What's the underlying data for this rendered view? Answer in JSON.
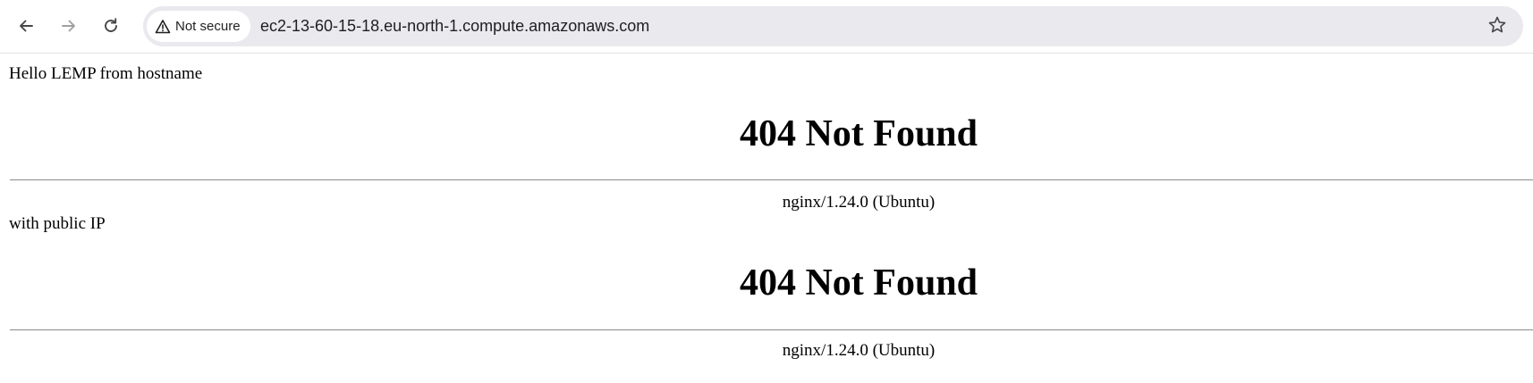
{
  "browser": {
    "security_chip_label": "Not secure",
    "url": "ec2-13-60-15-18.eu-north-1.compute.amazonaws.com",
    "icons": {
      "back": "arrow-left-icon",
      "forward": "arrow-right-icon",
      "reload": "reload-icon",
      "security": "warning-triangle-icon",
      "bookmark": "star-icon"
    },
    "colors": {
      "omnibox_bg": "#e9e9ee",
      "icon": "#474747",
      "icon_disabled": "#a0a0a0"
    }
  },
  "page": {
    "line_1": "Hello LEMP from hostname",
    "error_block_1": {
      "title": "404 Not Found",
      "server": "nginx/1.24.0 (Ubuntu)"
    },
    "line_2": "with public IP",
    "error_block_2": {
      "title": "404 Not Found",
      "server": "nginx/1.24.0 (Ubuntu)"
    }
  }
}
